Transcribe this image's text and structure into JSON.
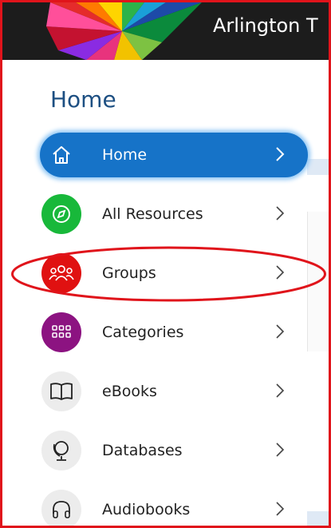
{
  "header": {
    "title": "Arlington T"
  },
  "page": {
    "heading": "Home"
  },
  "menu": {
    "items": [
      {
        "label": "Home",
        "icon": "home-icon",
        "color": "#1673c8"
      },
      {
        "label": "All Resources",
        "icon": "compass-icon",
        "color": "#18b83a"
      },
      {
        "label": "Groups",
        "icon": "people-icon",
        "color": "#e01111"
      },
      {
        "label": "Categories",
        "icon": "grid-icon",
        "color": "#8c1381"
      },
      {
        "label": "eBooks",
        "icon": "book-icon",
        "color": "#ececec"
      },
      {
        "label": "Databases",
        "icon": "globe-icon",
        "color": "#ececec"
      },
      {
        "label": "Audiobooks",
        "icon": "headphones-icon",
        "color": "#ececec"
      }
    ]
  },
  "annotation": {
    "highlight_color": "#e0141b"
  }
}
